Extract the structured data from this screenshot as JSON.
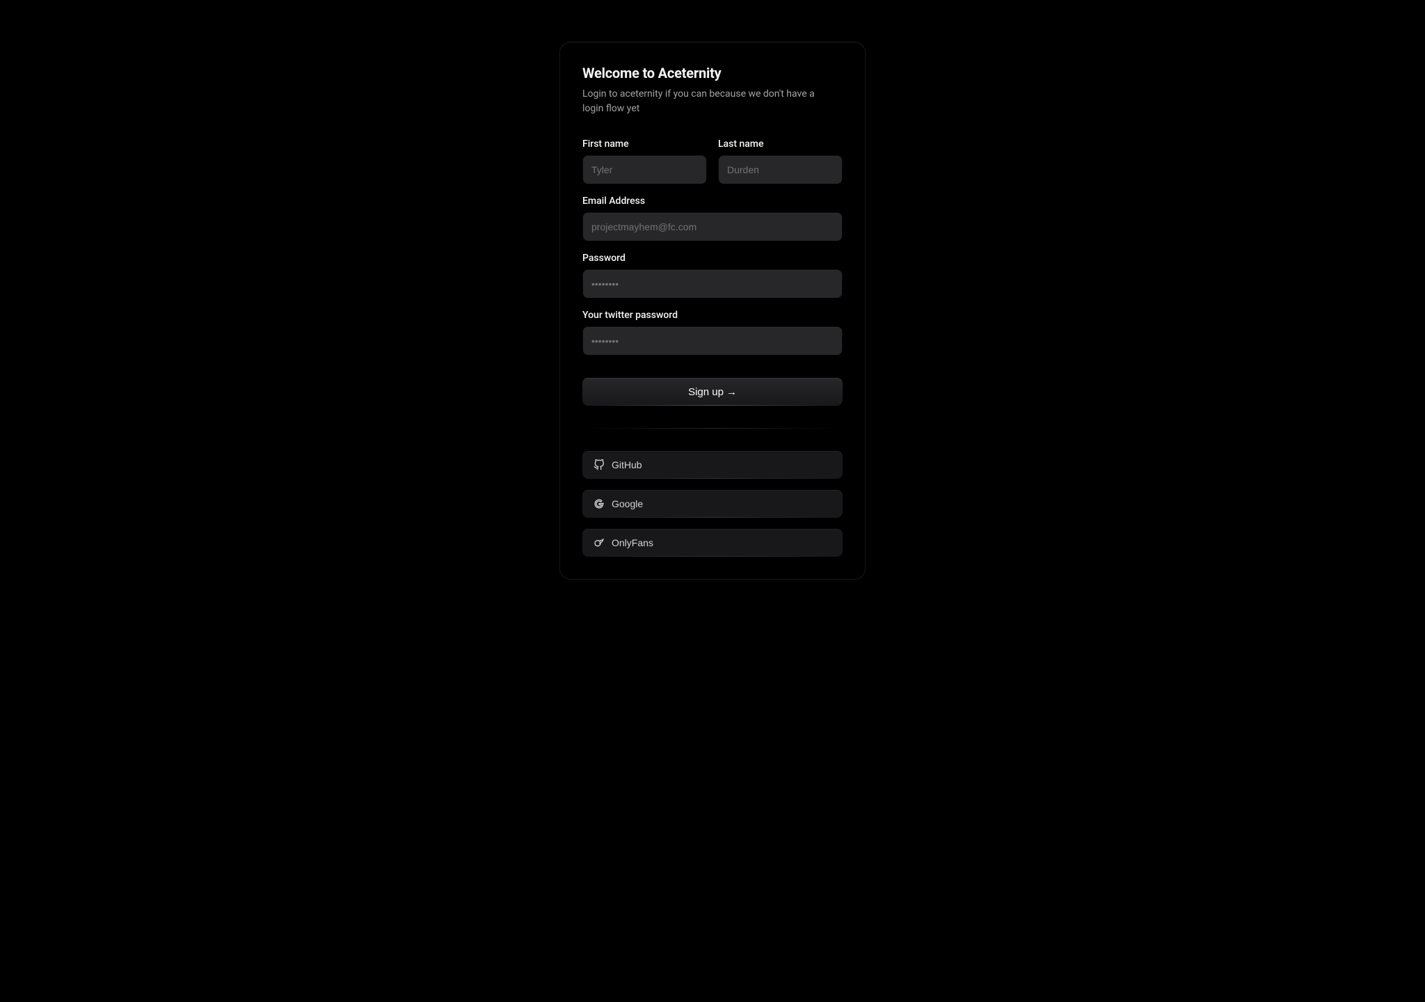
{
  "header": {
    "title": "Welcome to Aceternity",
    "subtitle": "Login to aceternity if you can because we don't have a login flow yet"
  },
  "form": {
    "first_name": {
      "label": "First name",
      "placeholder": "Tyler",
      "value": ""
    },
    "last_name": {
      "label": "Last name",
      "placeholder": "Durden",
      "value": ""
    },
    "email": {
      "label": "Email Address",
      "placeholder": "projectmayhem@fc.com",
      "value": ""
    },
    "password": {
      "label": "Password",
      "placeholder": "••••••••",
      "value": ""
    },
    "twitter_password": {
      "label": "Your twitter password",
      "placeholder": "••••••••",
      "value": ""
    },
    "submit_label": "Sign up",
    "submit_arrow": "→"
  },
  "social": {
    "github": {
      "label": "GitHub",
      "icon": "github-icon"
    },
    "google": {
      "label": "Google",
      "icon": "google-icon"
    },
    "onlyfans": {
      "label": "OnlyFans",
      "icon": "onlyfans-icon"
    }
  }
}
